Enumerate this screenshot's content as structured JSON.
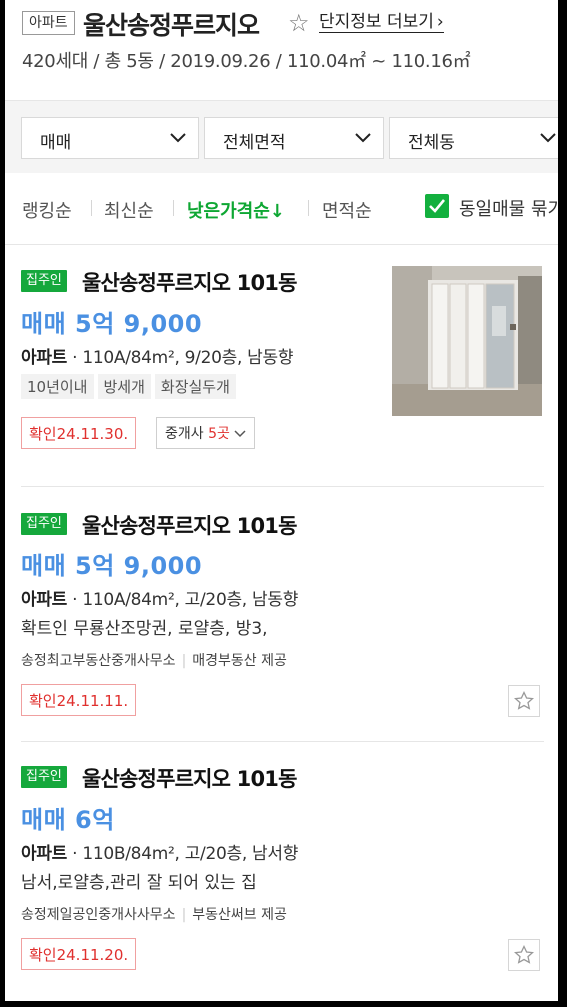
{
  "header": {
    "type_badge": "아파트",
    "complex_name": "울산송정푸르지오",
    "star_glyph": "☆",
    "detail_link": "단지정보 더보기",
    "summary": "420세대 / 총 5동 / 2019.09.26 / 110.04㎡ ~ 110.16㎡"
  },
  "filters": {
    "trade_type": "매매",
    "area": "전체면적",
    "building": "전체동"
  },
  "sort": {
    "items": [
      "랭킹순",
      "최신순",
      "낮은가격순↓",
      "면적순"
    ],
    "active_index": 2,
    "group_same_label": "동일매물 묶기",
    "group_same_checked": true,
    "accent_color": "#0ea733"
  },
  "listings": [
    {
      "owner_badge": "집주인",
      "name": "울산송정푸르지오 101동",
      "price": "매매 5억 9,000",
      "type": "아파트",
      "spec": "110A/84m², 9/20층, 남동향",
      "tags": [
        "10년이내",
        "방세개",
        "화장실두개"
      ],
      "confirm": "확인24.11.30.",
      "broker_label": "중개사",
      "broker_count": "5곳",
      "has_photo": true
    },
    {
      "owner_badge": "집주인",
      "name": "울산송정푸르지오 101동",
      "price": "매매 5억 9,000",
      "type": "아파트",
      "spec": "110A/84m², 고/20층, 남동향",
      "desc": "확트인 무룡산조망권, 로얄층, 방3,",
      "agency": "송정최고부동산중개사무소",
      "provider": "매경부동산 제공",
      "confirm": "확인24.11.11."
    },
    {
      "owner_badge": "집주인",
      "name": "울산송정푸르지오 101동",
      "price": "매매 6억",
      "type": "아파트",
      "spec": "110B/84m², 고/20층, 남서향",
      "desc": "남서,로얄층,관리 잘 되어 있는 집",
      "agency": "송정제일공인중개사사무소",
      "provider": "부동산써브 제공",
      "confirm": "확인24.11.20."
    }
  ]
}
